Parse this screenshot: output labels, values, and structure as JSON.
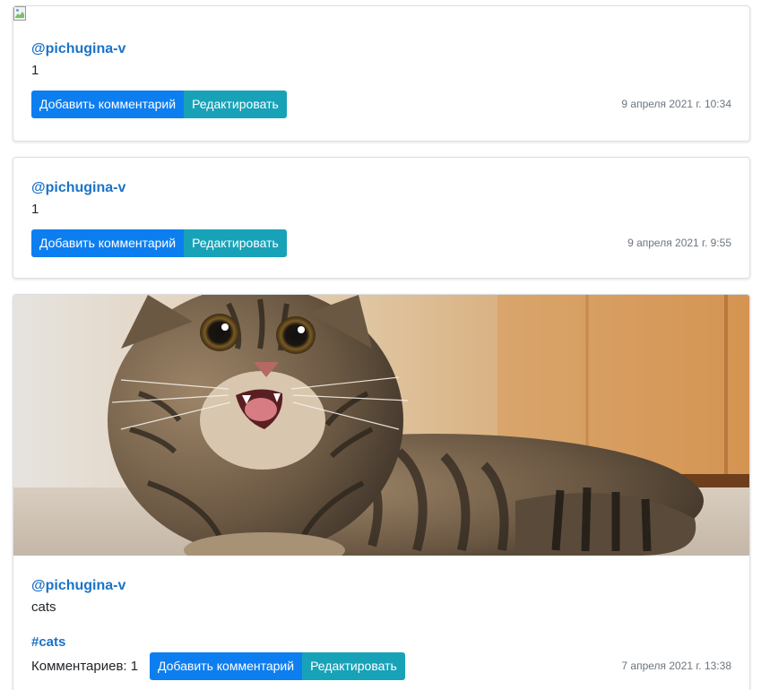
{
  "posts": [
    {
      "has_broken_image": true,
      "author": "@pichugina-v",
      "text": "1",
      "buttons": {
        "add_comment": "Добавить комментарий",
        "edit": "Редактировать"
      },
      "timestamp": "9 апреля 2021 г. 10:34"
    },
    {
      "author": "@pichugina-v",
      "text": "1",
      "buttons": {
        "add_comment": "Добавить комментарий",
        "edit": "Редактировать"
      },
      "timestamp": "9 апреля 2021 г. 9:55"
    },
    {
      "image": "cat-photo",
      "author": "@pichugina-v",
      "text": "cats",
      "hashtag": "#cats",
      "comments_count": "Комментариев: 1",
      "buttons": {
        "add_comment": "Добавить комментарий",
        "edit": "Редактировать"
      },
      "timestamp": "7 апреля 2021 г. 13:38"
    }
  ],
  "colors": {
    "link": "#1a73c8",
    "primary_button": "#0d7ef0",
    "info_button": "#17a2b8",
    "muted_text": "#6c757d"
  },
  "icons": {
    "broken_image": "broken-image-icon"
  }
}
